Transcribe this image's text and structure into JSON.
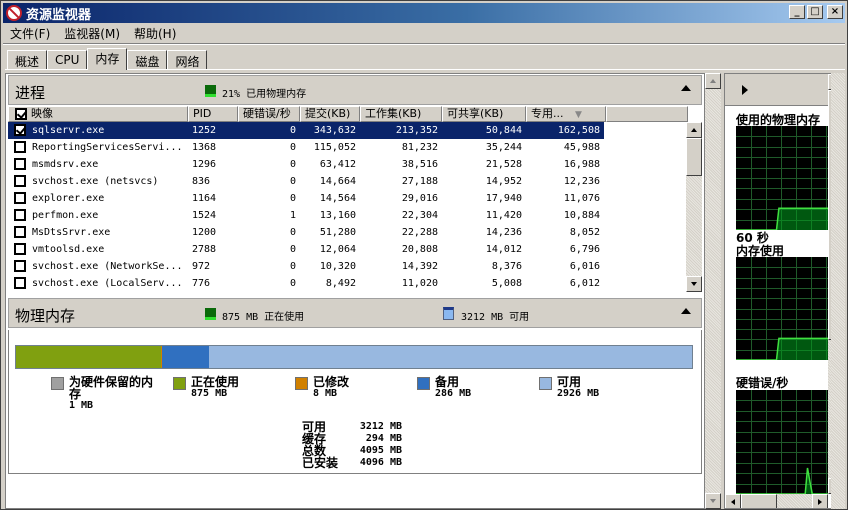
{
  "window": {
    "title": "资源监视器",
    "controls": [
      "_",
      "□",
      "×"
    ]
  },
  "menu": [
    {
      "label": "文件(F)"
    },
    {
      "label": "监视器(M)"
    },
    {
      "label": "帮助(H)"
    }
  ],
  "tabs": [
    {
      "label": "概述",
      "active": false
    },
    {
      "label": "CPU",
      "active": false
    },
    {
      "label": "内存",
      "active": true
    },
    {
      "label": "磁盘",
      "active": false
    },
    {
      "label": "网络",
      "active": false
    }
  ],
  "processes": {
    "title": "进程",
    "summary": "21% 已用物理内存",
    "columns": [
      "映像",
      "PID",
      "硬错误/秒",
      "提交(KB)",
      "工作集(KB)",
      "可共享(KB)",
      "专用..."
    ],
    "sorted_column": "专用...",
    "rows": [
      {
        "checked": true,
        "selected": true,
        "image": "sqlservr.exe",
        "pid": "1252",
        "hard_faults": "0",
        "commit": "343,632",
        "working_set": "213,352",
        "shareable": "50,844",
        "private": "162,508"
      },
      {
        "checked": false,
        "selected": false,
        "image": "ReportingServicesServi...",
        "pid": "1368",
        "hard_faults": "0",
        "commit": "115,052",
        "working_set": "81,232",
        "shareable": "35,244",
        "private": "45,988"
      },
      {
        "checked": false,
        "selected": false,
        "image": "msmdsrv.exe",
        "pid": "1296",
        "hard_faults": "0",
        "commit": "63,412",
        "working_set": "38,516",
        "shareable": "21,528",
        "private": "16,988"
      },
      {
        "checked": false,
        "selected": false,
        "image": "svchost.exe (netsvcs)",
        "pid": "836",
        "hard_faults": "0",
        "commit": "14,664",
        "working_set": "27,188",
        "shareable": "14,952",
        "private": "12,236"
      },
      {
        "checked": false,
        "selected": false,
        "image": "explorer.exe",
        "pid": "1164",
        "hard_faults": "0",
        "commit": "14,564",
        "working_set": "29,016",
        "shareable": "17,940",
        "private": "11,076"
      },
      {
        "checked": false,
        "selected": false,
        "image": "perfmon.exe",
        "pid": "1524",
        "hard_faults": "1",
        "commit": "13,160",
        "working_set": "22,304",
        "shareable": "11,420",
        "private": "10,884"
      },
      {
        "checked": false,
        "selected": false,
        "image": "MsDtsSrvr.exe",
        "pid": "1200",
        "hard_faults": "0",
        "commit": "51,280",
        "working_set": "22,288",
        "shareable": "14,236",
        "private": "8,052"
      },
      {
        "checked": false,
        "selected": false,
        "image": "vmtoolsd.exe",
        "pid": "2788",
        "hard_faults": "0",
        "commit": "12,064",
        "working_set": "20,808",
        "shareable": "14,012",
        "private": "6,796"
      },
      {
        "checked": false,
        "selected": false,
        "image": "svchost.exe (NetworkSe...",
        "pid": "972",
        "hard_faults": "0",
        "commit": "10,320",
        "working_set": "14,392",
        "shareable": "8,376",
        "private": "6,016"
      },
      {
        "checked": false,
        "selected": false,
        "image": "svchost.exe (LocalServ...",
        "pid": "776",
        "hard_faults": "0",
        "commit": "8,492",
        "working_set": "11,020",
        "shareable": "5,008",
        "private": "6,012"
      }
    ]
  },
  "physical_memory": {
    "title": "物理内存",
    "in_use_summary": "875 MB 正在使用",
    "available_summary": "3212 MB 可用",
    "bar": [
      {
        "name": "reserved",
        "mb": 1,
        "color": "#a0a0a0"
      },
      {
        "name": "in_use",
        "mb": 875,
        "color": "#80a010"
      },
      {
        "name": "modified",
        "mb": 8,
        "color": "#d08000"
      },
      {
        "name": "standby",
        "mb": 286,
        "color": "#3070c0"
      },
      {
        "name": "free",
        "mb": 2926,
        "color": "#98b8e0"
      }
    ],
    "legend": [
      {
        "label": "为硬件保留的内存",
        "value": "1 MB",
        "color": "#a0a0a0"
      },
      {
        "label": "正在使用",
        "value": "875 MB",
        "color": "#80a010"
      },
      {
        "label": "已修改",
        "value": "8 MB",
        "color": "#d08000"
      },
      {
        "label": "备用",
        "value": "286 MB",
        "color": "#3070c0"
      },
      {
        "label": "可用",
        "value": "2926 MB",
        "color": "#98b8e0"
      }
    ],
    "summary": [
      {
        "label": "可用",
        "value": "3212 MB"
      },
      {
        "label": "缓存",
        "value": "294 MB"
      },
      {
        "label": "总数",
        "value": "4095 MB"
      },
      {
        "label": "已安装",
        "value": "4096 MB"
      }
    ]
  },
  "graphs": {
    "graph1_title": "使用的物理内存",
    "time_label": "60 秒",
    "graph2_title": "内存使用",
    "graph3_title": "硬错误/秒",
    "graph1_percent_series": [
      0,
      0,
      0,
      0,
      0,
      0,
      0,
      0,
      0,
      0,
      0,
      0,
      0,
      0,
      0,
      0,
      0,
      0,
      21,
      21,
      21,
      21,
      21,
      21,
      21,
      21,
      21,
      21,
      21,
      21,
      21,
      21,
      21,
      21,
      21,
      21,
      21,
      21,
      21,
      21
    ],
    "graph2_percent_series": [
      0,
      0,
      0,
      0,
      0,
      0,
      0,
      0,
      0,
      0,
      0,
      0,
      0,
      0,
      0,
      0,
      0,
      0,
      21,
      21,
      21,
      21,
      21,
      21,
      21,
      21,
      21,
      21,
      21,
      21,
      21,
      21,
      21,
      21,
      21,
      21,
      21,
      21,
      21,
      21
    ],
    "graph3_percent_series": [
      0,
      0,
      0,
      0,
      0,
      0,
      0,
      0,
      0,
      0,
      0,
      0,
      0,
      0,
      0,
      0,
      0,
      0,
      0,
      0,
      0,
      0,
      0,
      0,
      0,
      0,
      0,
      0,
      0,
      0,
      25,
      12,
      0,
      0,
      0,
      0,
      0,
      0,
      0,
      0
    ]
  }
}
